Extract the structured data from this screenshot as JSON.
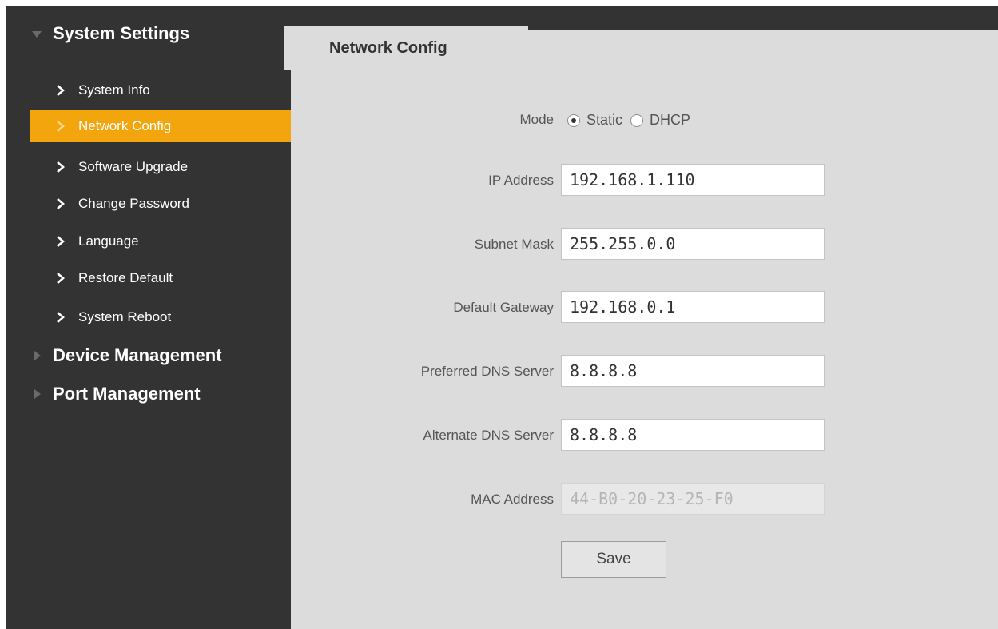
{
  "sidebar": {
    "system_settings": "System Settings",
    "items": [
      {
        "label": "System Info"
      },
      {
        "label": "Network Config"
      },
      {
        "label": "Software Upgrade"
      },
      {
        "label": "Change Password"
      },
      {
        "label": "Language"
      },
      {
        "label": "Restore Default"
      },
      {
        "label": "System Reboot"
      }
    ],
    "active_item": "Network Config",
    "device_management": "Device Management",
    "port_management": "Port Management"
  },
  "tab": {
    "label": "Network Config"
  },
  "form": {
    "mode_label": "Mode",
    "mode_options": [
      "Static",
      "DHCP"
    ],
    "mode_selected": "Static",
    "ip_label": "IP Address",
    "ip_value": "192.168.1.110",
    "subnet_label": "Subnet Mask",
    "subnet_value": "255.255.0.0",
    "gateway_label": "Default Gateway",
    "gateway_value": "192.168.0.1",
    "dns1_label": "Preferred DNS Server",
    "dns1_value": "8.8.8.8",
    "dns2_label": "Alternate DNS Server",
    "dns2_value": "8.8.8.8",
    "mac_label": "MAC Address",
    "mac_value": "44-B0-20-23-25-F0",
    "save_label": "Save"
  },
  "colors": {
    "sidebar_bg": "#333333",
    "active_bg": "#f2a50c",
    "main_bg": "#dcdcdc"
  }
}
